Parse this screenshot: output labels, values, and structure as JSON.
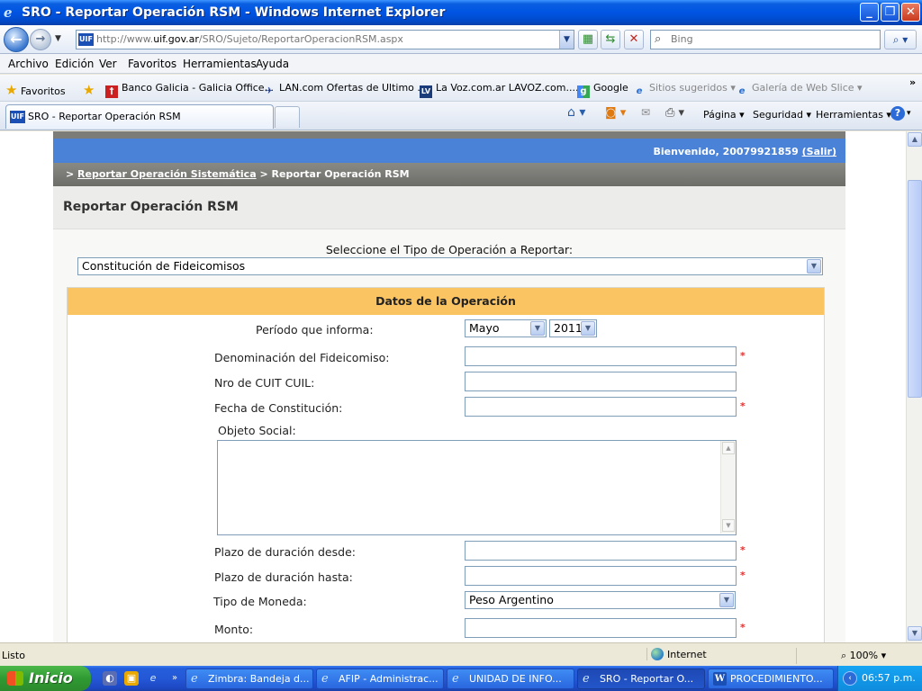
{
  "window": {
    "title": "SRO - Reportar Operación RSM - Windows Internet Explorer",
    "minimize_glyph": "_",
    "maximize_glyph": "❐",
    "close_glyph": "✕"
  },
  "address": {
    "url_prefix": "http://www.",
    "url_domain": "uif.gov.ar",
    "url_path": "/SRO/Sujeto/ReportarOperacionRSM.aspx",
    "site_badge": "UIF",
    "search_placeholder": "Bing"
  },
  "menu": [
    "Archivo",
    "Edición",
    "Ver",
    "Favoritos",
    "Herramientas",
    "Ayuda"
  ],
  "favorites": {
    "label": "Favoritos",
    "items": [
      {
        "label": "Banco Galicia - Galicia Office...",
        "icon": "galicia-icon",
        "color": "#cc1f1f"
      },
      {
        "label": "LAN.com Ofertas de Ultimo ...",
        "icon": "lan-icon",
        "color": "#1a3b8f"
      },
      {
        "label": "La Voz.com.ar  LAVOZ.com....",
        "icon": "lavoz-icon",
        "color": "#1b3c7a"
      },
      {
        "label": "Google",
        "icon": "google-icon",
        "color": "#4285f4"
      },
      {
        "label": "Sitios sugeridos ▾",
        "icon": "ie-icon",
        "color": "#2b6fd2"
      },
      {
        "label": "Galería de Web Slice ▾",
        "icon": "ie-icon",
        "color": "#2b6fd2"
      }
    ],
    "more": "»"
  },
  "tab": {
    "title": "SRO - Reportar Operación RSM",
    "badge": "UIF"
  },
  "commands": {
    "page": "Página ▾",
    "security": "Seguridad ▾",
    "tools": "Herramientas ▾",
    "help": "?"
  },
  "page": {
    "welcome_prefix": "Bienvenido, 20079921859 ",
    "logout": "(Salir)",
    "breadcrumb_prefix": "> ",
    "breadcrumb_link": "Reportar Operación Sistemática",
    "breadcrumb_current": " > Reportar Operación RSM",
    "heading": "Reportar Operación RSM",
    "select_label": "Seleccione el Tipo de Operación a Reportar:",
    "operation_type": "Constitución de Fideicomisos",
    "panel_title": "Datos de la Operación",
    "period_label": "Período que informa:",
    "period_month": "Mayo",
    "period_year": "2011",
    "denomination_label": "Denominación del Fideicomiso:",
    "cuit_label": "Nro de CUIT CUIL:",
    "constitution_date_label": "Fecha de Constitución:",
    "social_object_label": "Objeto Social:",
    "duration_from_label": "Plazo de duración desde:",
    "duration_to_label": "Plazo de duración hasta:",
    "currency_label": "Tipo de Moneda:",
    "currency_value": "Peso Argentino",
    "amount_label": "Monto:",
    "required_mark": "*"
  },
  "status": {
    "text": "Listo",
    "zone": "Internet",
    "zoom": "100%"
  },
  "taskbar": {
    "start": "Inicio",
    "windows": [
      {
        "label": "Zimbra: Bandeja d...",
        "icon": "ie-icon"
      },
      {
        "label": "AFIP - Administrac...",
        "icon": "ie-icon"
      },
      {
        "label": "UNIDAD DE INFO...",
        "icon": "ie-icon"
      },
      {
        "label": "SRO - Reportar O...",
        "icon": "ie-icon"
      },
      {
        "label": "PROCEDIMIENTO...",
        "icon": "word-icon"
      }
    ],
    "clock": "06:57 p.m."
  },
  "colors": {
    "welcome_bar": "#4a82d8",
    "panel_header": "#fbc462",
    "required": "#e03030"
  }
}
